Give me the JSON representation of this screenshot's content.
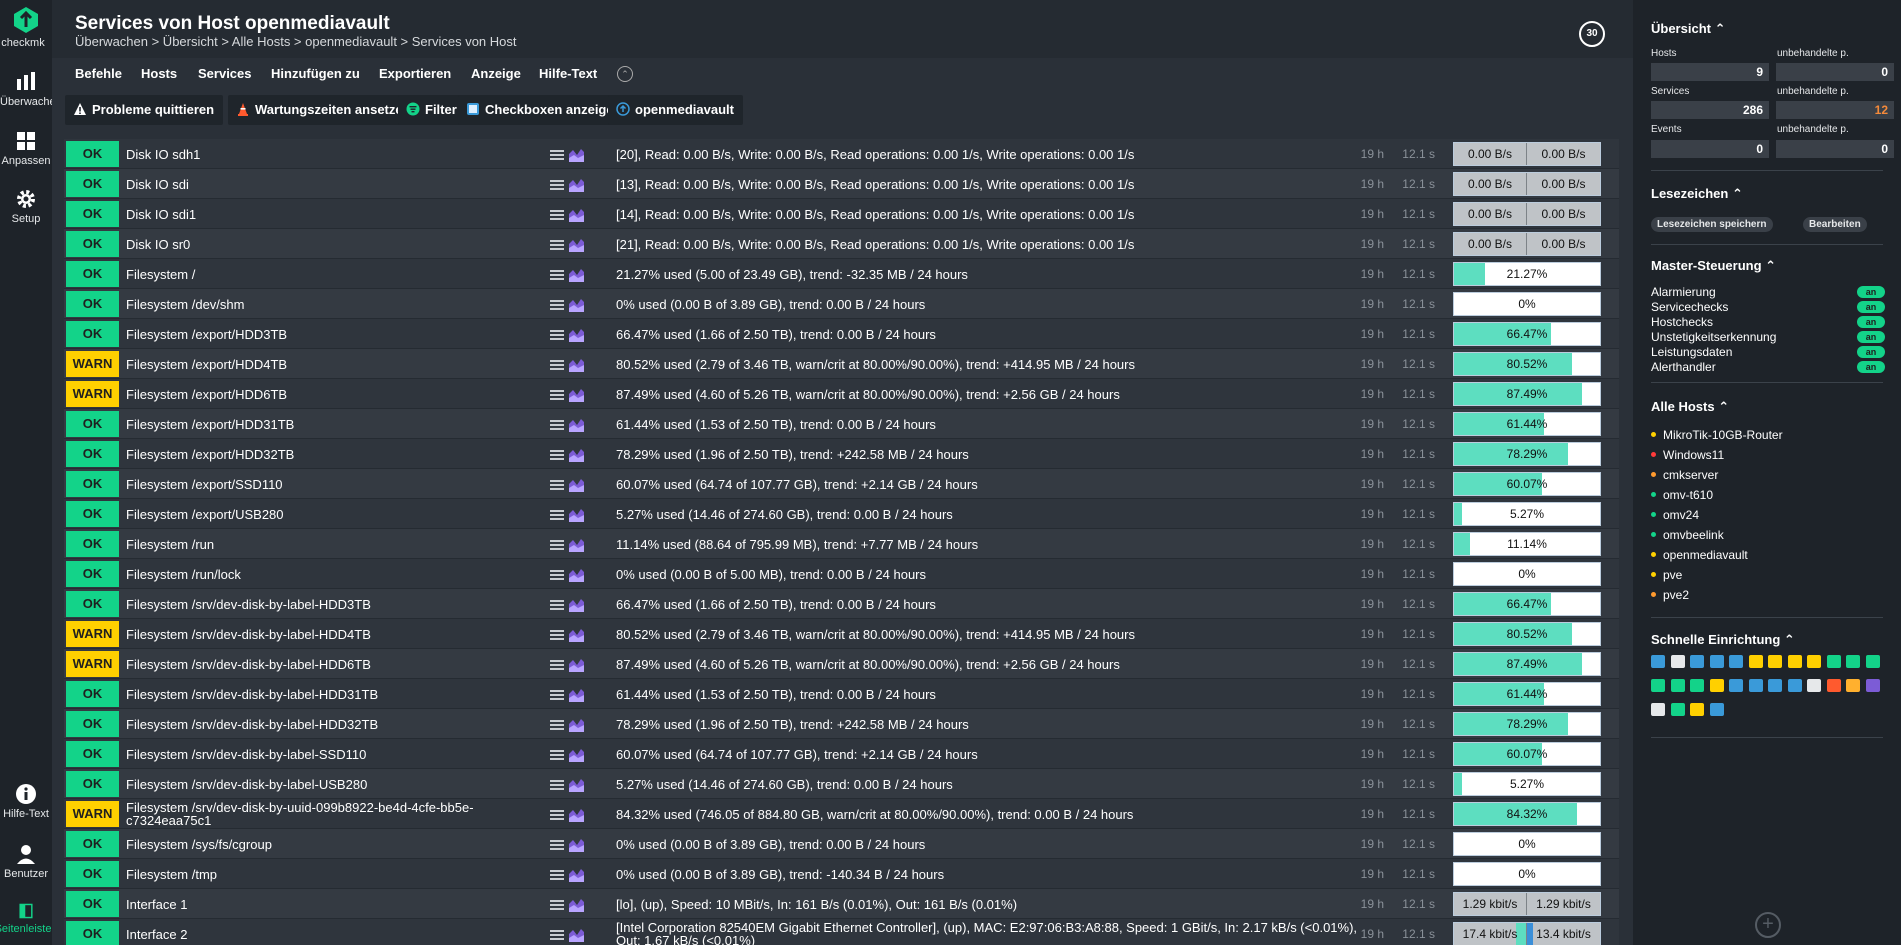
{
  "app": {
    "logo_text": "checkmk"
  },
  "leftnav": {
    "items": [
      {
        "label": "Überwachen",
        "icon": "bar-chart-icon"
      },
      {
        "label": "Anpassen",
        "icon": "grid-icon"
      },
      {
        "label": "Setup",
        "icon": "gear-icon"
      },
      {
        "label": "Hilfe-Text",
        "icon": "info-icon"
      },
      {
        "label": "Benutzer",
        "icon": "user-icon"
      },
      {
        "label": "Seitenleiste",
        "icon": "sidebar-icon"
      }
    ]
  },
  "header": {
    "title": "Services von Host openmediavault",
    "breadcrumb": "Überwachen > Übersicht > Alle Hosts > openmediavault > Services von Host",
    "refresh_seconds": "30"
  },
  "menu": {
    "items": [
      "Befehle",
      "Hosts",
      "Services",
      "Hinzufügen zu",
      "Exportieren",
      "Anzeige",
      "Hilfe-Text"
    ]
  },
  "toolbar": {
    "buttons": [
      {
        "label": "Probleme quittieren",
        "icon": "warning-icon"
      },
      {
        "label": "Wartungszeiten ansetzen",
        "icon": "cone-icon"
      },
      {
        "label": "Filter",
        "icon": "filter-icon"
      },
      {
        "label": "Checkboxen anzeigen",
        "icon": "checkbox-icon"
      },
      {
        "label": "openmediavault",
        "icon": "host-icon"
      }
    ]
  },
  "services": [
    {
      "state": "OK",
      "name": "Disk IO sdh1",
      "output": "[20], Read: 0.00 B/s, Write: 0.00 B/s, Read operations: 0.00 1/s, Write operations: 0.00 1/s",
      "age": "19 h",
      "check": "12.1 s",
      "perf_left": "0.00 B/s",
      "perf_right": "0.00 B/s"
    },
    {
      "state": "OK",
      "name": "Disk IO sdi",
      "output": "[13], Read: 0.00 B/s, Write: 0.00 B/s, Read operations: 0.00 1/s, Write operations: 0.00 1/s",
      "age": "19 h",
      "check": "12.1 s",
      "perf_left": "0.00 B/s",
      "perf_right": "0.00 B/s"
    },
    {
      "state": "OK",
      "name": "Disk IO sdi1",
      "output": "[14], Read: 0.00 B/s, Write: 0.00 B/s, Read operations: 0.00 1/s, Write operations: 0.00 1/s",
      "age": "19 h",
      "check": "12.1 s",
      "perf_left": "0.00 B/s",
      "perf_right": "0.00 B/s"
    },
    {
      "state": "OK",
      "name": "Disk IO sr0",
      "output": "[21], Read: 0.00 B/s, Write: 0.00 B/s, Read operations: 0.00 1/s, Write operations: 0.00 1/s",
      "age": "19 h",
      "check": "12.1 s",
      "perf_left": "0.00 B/s",
      "perf_right": "0.00 B/s"
    },
    {
      "state": "OK",
      "name": "Filesystem /",
      "output": "21.27% used (5.00 of 23.49 GB), trend: -32.35 MB / 24 hours",
      "age": "19 h",
      "check": "12.1 s",
      "perf": "21.27%",
      "pct": 21.27
    },
    {
      "state": "OK",
      "name": "Filesystem /dev/shm",
      "output": "0% used (0.00 B of 3.89 GB), trend: 0.00 B / 24 hours",
      "age": "19 h",
      "check": "12.1 s",
      "perf": "0%",
      "pct": 0
    },
    {
      "state": "OK",
      "name": "Filesystem /export/HDD3TB",
      "output": "66.47% used (1.66 of 2.50 TB), trend: 0.00 B / 24 hours",
      "age": "19 h",
      "check": "12.1 s",
      "perf": "66.47%",
      "pct": 66.47
    },
    {
      "state": "WARN",
      "name": "Filesystem /export/HDD4TB",
      "output": "80.52% used (2.79 of 3.46 TB, warn/crit at 80.00%/90.00%), trend: +414.95 MB / 24 hours",
      "age": "19 h",
      "check": "12.1 s",
      "perf": "80.52%",
      "pct": 80.52
    },
    {
      "state": "WARN",
      "name": "Filesystem /export/HDD6TB",
      "output": "87.49% used (4.60 of 5.26 TB, warn/crit at 80.00%/90.00%), trend: +2.56 GB / 24 hours",
      "age": "19 h",
      "check": "12.1 s",
      "perf": "87.49%",
      "pct": 87.49
    },
    {
      "state": "OK",
      "name": "Filesystem /export/HDD31TB",
      "output": "61.44% used (1.53 of 2.50 TB), trend: 0.00 B / 24 hours",
      "age": "19 h",
      "check": "12.1 s",
      "perf": "61.44%",
      "pct": 61.44
    },
    {
      "state": "OK",
      "name": "Filesystem /export/HDD32TB",
      "output": "78.29% used (1.96 of 2.50 TB), trend: +242.58 MB / 24 hours",
      "age": "19 h",
      "check": "12.1 s",
      "perf": "78.29%",
      "pct": 78.29
    },
    {
      "state": "OK",
      "name": "Filesystem /export/SSD110",
      "output": "60.07% used (64.74 of 107.77 GB), trend: +2.14 GB / 24 hours",
      "age": "19 h",
      "check": "12.1 s",
      "perf": "60.07%",
      "pct": 60.07
    },
    {
      "state": "OK",
      "name": "Filesystem /export/USB280",
      "output": "5.27% used (14.46 of 274.60 GB), trend: 0.00 B / 24 hours",
      "age": "19 h",
      "check": "12.1 s",
      "perf": "5.27%",
      "pct": 5.27
    },
    {
      "state": "OK",
      "name": "Filesystem /run",
      "output": "11.14% used (88.64 of 795.99 MB), trend: +7.77 MB / 24 hours",
      "age": "19 h",
      "check": "12.1 s",
      "perf": "11.14%",
      "pct": 11.14
    },
    {
      "state": "OK",
      "name": "Filesystem /run/lock",
      "output": "0% used (0.00 B of 5.00 MB), trend: 0.00 B / 24 hours",
      "age": "19 h",
      "check": "12.1 s",
      "perf": "0%",
      "pct": 0
    },
    {
      "state": "OK",
      "name": "Filesystem /srv/dev-disk-by-label-HDD3TB",
      "output": "66.47% used (1.66 of 2.50 TB), trend: 0.00 B / 24 hours",
      "age": "19 h",
      "check": "12.1 s",
      "perf": "66.47%",
      "pct": 66.47
    },
    {
      "state": "WARN",
      "name": "Filesystem /srv/dev-disk-by-label-HDD4TB",
      "output": "80.52% used (2.79 of 3.46 TB, warn/crit at 80.00%/90.00%), trend: +414.95 MB / 24 hours",
      "age": "19 h",
      "check": "12.1 s",
      "perf": "80.52%",
      "pct": 80.52
    },
    {
      "state": "WARN",
      "name": "Filesystem /srv/dev-disk-by-label-HDD6TB",
      "output": "87.49% used (4.60 of 5.26 TB, warn/crit at 80.00%/90.00%), trend: +2.56 GB / 24 hours",
      "age": "19 h",
      "check": "12.1 s",
      "perf": "87.49%",
      "pct": 87.49
    },
    {
      "state": "OK",
      "name": "Filesystem /srv/dev-disk-by-label-HDD31TB",
      "output": "61.44% used (1.53 of 2.50 TB), trend: 0.00 B / 24 hours",
      "age": "19 h",
      "check": "12.1 s",
      "perf": "61.44%",
      "pct": 61.44
    },
    {
      "state": "OK",
      "name": "Filesystem /srv/dev-disk-by-label-HDD32TB",
      "output": "78.29% used (1.96 of 2.50 TB), trend: +242.58 MB / 24 hours",
      "age": "19 h",
      "check": "12.1 s",
      "perf": "78.29%",
      "pct": 78.29
    },
    {
      "state": "OK",
      "name": "Filesystem /srv/dev-disk-by-label-SSD110",
      "output": "60.07% used (64.74 of 107.77 GB), trend: +2.14 GB / 24 hours",
      "age": "19 h",
      "check": "12.1 s",
      "perf": "60.07%",
      "pct": 60.07
    },
    {
      "state": "OK",
      "name": "Filesystem /srv/dev-disk-by-label-USB280",
      "output": "5.27% used (14.46 of 274.60 GB), trend: 0.00 B / 24 hours",
      "age": "19 h",
      "check": "12.1 s",
      "perf": "5.27%",
      "pct": 5.27
    },
    {
      "state": "WARN",
      "name": "Filesystem /srv/dev-disk-by-uuid-099b8922-be4d-4cfe-bb5e-c7324eaa75c1",
      "output": "84.32% used (746.05 of 884.80 GB, warn/crit at 80.00%/90.00%), trend: 0.00 B / 24 hours",
      "age": "19 h",
      "check": "12.1 s",
      "perf": "84.32%",
      "pct": 84.32
    },
    {
      "state": "OK",
      "name": "Filesystem /sys/fs/cgroup",
      "output": "0% used (0.00 B of 3.89 GB), trend: 0.00 B / 24 hours",
      "age": "19 h",
      "check": "12.1 s",
      "perf": "0%",
      "pct": 0
    },
    {
      "state": "OK",
      "name": "Filesystem /tmp",
      "output": "0% used (0.00 B of 3.89 GB), trend: -140.34 B / 24 hours",
      "age": "19 h",
      "check": "12.1 s",
      "perf": "0%",
      "pct": 0
    },
    {
      "state": "OK",
      "name": "Interface 1",
      "output": "[lo], (up), Speed: 10 MBit/s, In: 161 B/s (0.01%), Out: 161 B/s (0.01%)",
      "age": "19 h",
      "check": "12.1 s",
      "perf_left": "1.29 kbit/s",
      "perf_right": "1.29 kbit/s"
    },
    {
      "state": "OK",
      "name": "Interface 2",
      "output": "[Intel Corporation 82540EM Gigabit Ethernet Controller], (up), MAC: E2:97:06:B3:A8:88, Speed: 1 GBit/s, In: 2.17 kB/s (<0.01%), Out: 1.67 kB/s (<0.01%)",
      "age": "19 h",
      "check": "12.1 s",
      "perf_left": "17.4 kbit/s",
      "perf_right": "13.4 kbit/s",
      "fill": true
    }
  ],
  "sidebar": {
    "overview": {
      "title": "Übersicht",
      "hosts_label": "Hosts",
      "hosts": "9",
      "hosts_unhandled_label": "unbehandelte p.",
      "hosts_unhandled": "0",
      "services_label": "Services",
      "services": "286",
      "services_unhandled_label": "unbehandelte p.",
      "services_unhandled": "12",
      "events_label": "Events",
      "events": "0",
      "events_unhandled_label": "unbehandelte p.",
      "events_unhandled": "0"
    },
    "bookmarks": {
      "title": "Lesezeichen",
      "save_label": "Lesezeichen speichern",
      "edit_label": "Bearbeiten"
    },
    "master_control": {
      "title": "Master-Steuerung",
      "items": [
        {
          "label": "Alarmierung",
          "state": "an"
        },
        {
          "label": "Servicechecks",
          "state": "an"
        },
        {
          "label": "Hostchecks",
          "state": "an"
        },
        {
          "label": "Unstetigkeitserkennung",
          "state": "an"
        },
        {
          "label": "Leistungsdaten",
          "state": "an"
        },
        {
          "label": "Alerthandler",
          "state": "an"
        }
      ]
    },
    "all_hosts": {
      "title": "Alle Hosts",
      "items": [
        {
          "name": "MikroTik-10GB-Router",
          "color": "#ffd000"
        },
        {
          "name": "Windows11",
          "color": "#ff3b3b"
        },
        {
          "name": "cmkserver",
          "color": "#ff9a2e"
        },
        {
          "name": "omv-t610",
          "color": "#13d389"
        },
        {
          "name": "omv24",
          "color": "#13d389"
        },
        {
          "name": "omvbeelink",
          "color": "#13d389"
        },
        {
          "name": "openmediavault",
          "color": "#ffd000"
        },
        {
          "name": "pve",
          "color": "#ffd000"
        },
        {
          "name": "pve2",
          "color": "#ff9a2e"
        }
      ]
    },
    "quicksetup": {
      "title": "Schnelle Einrichtung"
    }
  },
  "colors": {
    "ok": "#13d389",
    "warn": "#ffd000",
    "perf_fill": "#5ddec0",
    "accent": "#13d389"
  }
}
